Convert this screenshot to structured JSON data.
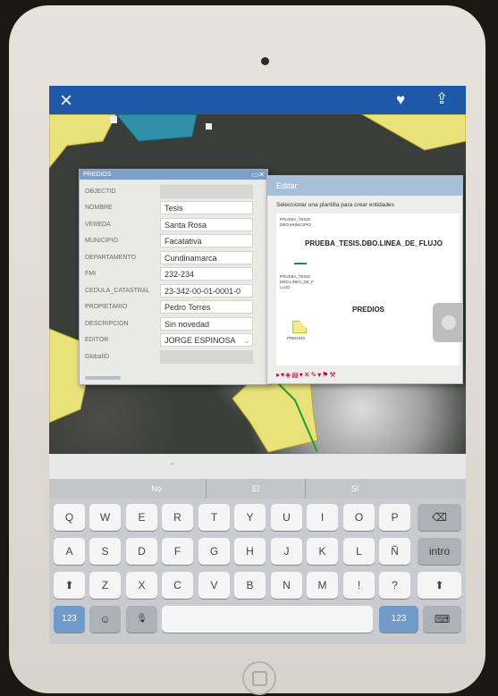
{
  "toolbar": {
    "close_icon": "×",
    "favorite_icon": "♥",
    "share_icon": "⇪"
  },
  "map": {
    "scale_mark": "⌄"
  },
  "predios_panel": {
    "title": "PREDIOS",
    "controls": "▭✕",
    "rows": [
      {
        "label": "OBJECTID",
        "value": ""
      },
      {
        "label": "NOMBRE",
        "value": "Tesis"
      },
      {
        "label": "VEREDA",
        "value": "Santa Rosa"
      },
      {
        "label": "MUNICIPIO",
        "value": "Facatativa"
      },
      {
        "label": "DEPARTAMENTO",
        "value": "Cundinamarca"
      },
      {
        "label": "FMI",
        "value": "232-234"
      },
      {
        "label": "CEDULA_CATASTRAL",
        "value": "23-342-00-01-0001-0"
      },
      {
        "label": "PROPIETARIO",
        "value": "Pedro Torres"
      },
      {
        "label": "DESCRIPCION",
        "value": "Sin novedad"
      },
      {
        "label": "EDITOR",
        "value": "JORGE ESPINOSA"
      },
      {
        "label": "GlobalID",
        "value": ""
      }
    ],
    "editor_dropdown": "⌄"
  },
  "edit_panel": {
    "title": "Editar",
    "instruction": "Seleccionar una plantilla para crear entidades",
    "group1_small": "PRUEBA_TESIS DBO.MUNICIPIO",
    "template1": "PRUEBA_TESIS.DBO.LINEA_DE_FLUJO",
    "group2_small": "PRUEBA_TESIS DBO.LINEA_DE_F LUJO",
    "template2": "PREDIOS",
    "group3_small": "PREDIOS",
    "tool_icons": "▸▾◈▤▾✕✎▾⚑⚒ "
  },
  "keyboard": {
    "suggestions": [
      "No",
      "El",
      "Sí"
    ],
    "row1": [
      "Q",
      "W",
      "E",
      "R",
      "T",
      "Y",
      "U",
      "I",
      "O",
      "P"
    ],
    "backspace": "⌫",
    "row2": [
      "A",
      "S",
      "D",
      "F",
      "G",
      "H",
      "J",
      "K",
      "L",
      "Ñ"
    ],
    "return_label": "intro",
    "shift": "⬆",
    "row3": [
      "Z",
      "X",
      "C",
      "V",
      "B",
      "N",
      "M",
      "!",
      "?"
    ],
    "numbers_label": "123",
    "emoji": "☺",
    "mic": "🎙",
    "hide_kb": "⌨"
  }
}
